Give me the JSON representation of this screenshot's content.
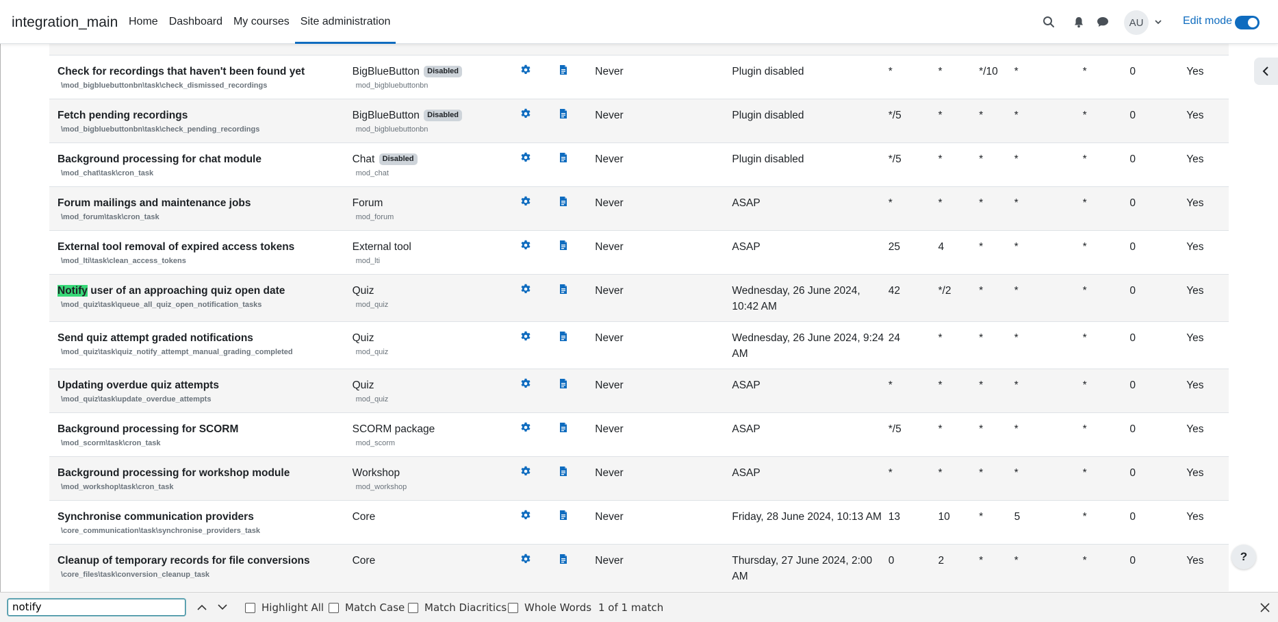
{
  "navbar": {
    "site_name": "integration_main",
    "links": [
      "Home",
      "Dashboard",
      "My courses",
      "Site administration"
    ],
    "active_link": "Site administration",
    "avatar_initials": "AU",
    "edit_mode_label": "Edit mode",
    "edit_mode_on": true,
    "icons": [
      "search-icon",
      "bell-icon",
      "chat-icon",
      "chevron-down-icon"
    ]
  },
  "table": {
    "rows": [
      {
        "name": "Check for recordings that haven't been found yet",
        "class": "\\mod_bigbluebuttonbn\\task\\check_dismissed_recordings",
        "component": "BigBlueButton",
        "badge": "Disabled",
        "component_sub": "mod_bigbluebuttonbn",
        "last_run": "Never",
        "next_run": "Plugin disabled",
        "minute": "*",
        "hour": "*",
        "day": "*/10",
        "month": "*",
        "dow": "*",
        "fail_delay": "0",
        "default": "Yes"
      },
      {
        "name": "Fetch pending recordings",
        "class": "\\mod_bigbluebuttonbn\\task\\check_pending_recordings",
        "component": "BigBlueButton",
        "badge": "Disabled",
        "component_sub": "mod_bigbluebuttonbn",
        "last_run": "Never",
        "next_run": "Plugin disabled",
        "minute": "*/5",
        "hour": "*",
        "day": "*",
        "month": "*",
        "dow": "*",
        "fail_delay": "0",
        "default": "Yes"
      },
      {
        "name": "Background processing for chat module",
        "class": "\\mod_chat\\task\\cron_task",
        "component": "Chat",
        "badge": "Disabled",
        "component_sub": "mod_chat",
        "last_run": "Never",
        "next_run": "Plugin disabled",
        "minute": "*/5",
        "hour": "*",
        "day": "*",
        "month": "*",
        "dow": "*",
        "fail_delay": "0",
        "default": "Yes"
      },
      {
        "name": "Forum mailings and maintenance jobs",
        "class": "\\mod_forum\\task\\cron_task",
        "component": "Forum",
        "badge": "",
        "component_sub": "mod_forum",
        "last_run": "Never",
        "next_run": "ASAP",
        "minute": "*",
        "hour": "*",
        "day": "*",
        "month": "*",
        "dow": "*",
        "fail_delay": "0",
        "default": "Yes"
      },
      {
        "name": "External tool removal of expired access tokens",
        "class": "\\mod_lti\\task\\clean_access_tokens",
        "component": "External tool",
        "badge": "",
        "component_sub": "mod_lti",
        "last_run": "Never",
        "next_run": "ASAP",
        "minute": "25",
        "hour": "4",
        "day": "*",
        "month": "*",
        "dow": "*",
        "fail_delay": "0",
        "default": "Yes"
      },
      {
        "name_highlight": "Notify",
        "name": " user of an approaching quiz open date",
        "class": "\\mod_quiz\\task\\queue_all_quiz_open_notification_tasks",
        "component": "Quiz",
        "badge": "",
        "component_sub": "mod_quiz",
        "last_run": "Never",
        "next_run": "Wednesday, 26 June 2024, 10:42 AM",
        "minute": "42",
        "hour": "*/2",
        "day": "*",
        "month": "*",
        "dow": "*",
        "fail_delay": "0",
        "default": "Yes"
      },
      {
        "name": "Send quiz attempt graded notifications",
        "class": "\\mod_quiz\\task\\quiz_notify_attempt_manual_grading_completed",
        "component": "Quiz",
        "badge": "",
        "component_sub": "mod_quiz",
        "last_run": "Never",
        "next_run": "Wednesday, 26 June 2024, 9:24 AM",
        "minute": "24",
        "hour": "*",
        "day": "*",
        "month": "*",
        "dow": "*",
        "fail_delay": "0",
        "default": "Yes"
      },
      {
        "name": "Updating overdue quiz attempts",
        "class": "\\mod_quiz\\task\\update_overdue_attempts",
        "component": "Quiz",
        "badge": "",
        "component_sub": "mod_quiz",
        "last_run": "Never",
        "next_run": "ASAP",
        "minute": "*",
        "hour": "*",
        "day": "*",
        "month": "*",
        "dow": "*",
        "fail_delay": "0",
        "default": "Yes"
      },
      {
        "name": "Background processing for SCORM",
        "class": "\\mod_scorm\\task\\cron_task",
        "component": "SCORM package",
        "badge": "",
        "component_sub": "mod_scorm",
        "last_run": "Never",
        "next_run": "ASAP",
        "minute": "*/5",
        "hour": "*",
        "day": "*",
        "month": "*",
        "dow": "*",
        "fail_delay": "0",
        "default": "Yes"
      },
      {
        "name": "Background processing for workshop module",
        "class": "\\mod_workshop\\task\\cron_task",
        "component": "Workshop",
        "badge": "",
        "component_sub": "mod_workshop",
        "last_run": "Never",
        "next_run": "ASAP",
        "minute": "*",
        "hour": "*",
        "day": "*",
        "month": "*",
        "dow": "*",
        "fail_delay": "0",
        "default": "Yes"
      },
      {
        "name": "Synchronise communication providers",
        "class": "\\core_communication\\task\\synchronise_providers_task",
        "component": "Core",
        "badge": "",
        "component_sub": "",
        "last_run": "Never",
        "next_run": "Friday, 28 June 2024, 10:13 AM",
        "minute": "13",
        "hour": "10",
        "day": "*",
        "month": "5",
        "dow": "*",
        "fail_delay": "0",
        "default": "Yes"
      },
      {
        "name": "Cleanup of temporary records for file conversions",
        "class": "\\core_files\\task\\conversion_cleanup_task",
        "component": "Core",
        "badge": "",
        "component_sub": "",
        "last_run": "Never",
        "next_run": "Thursday, 27 June 2024, 2:00 AM",
        "minute": "0",
        "hour": "2",
        "day": "*",
        "month": "*",
        "dow": "*",
        "fail_delay": "0",
        "default": "Yes"
      }
    ]
  },
  "findbar": {
    "query": "notify",
    "checkboxes": [
      "Highlight All",
      "Match Case",
      "Match Diacritics",
      "Whole Words"
    ],
    "match_count": "1 of 1 match"
  },
  "help_label": "?",
  "colors": {
    "accent": "#0f6cbf",
    "highlight": "#38d878",
    "stripe": "#f5f5f5"
  }
}
